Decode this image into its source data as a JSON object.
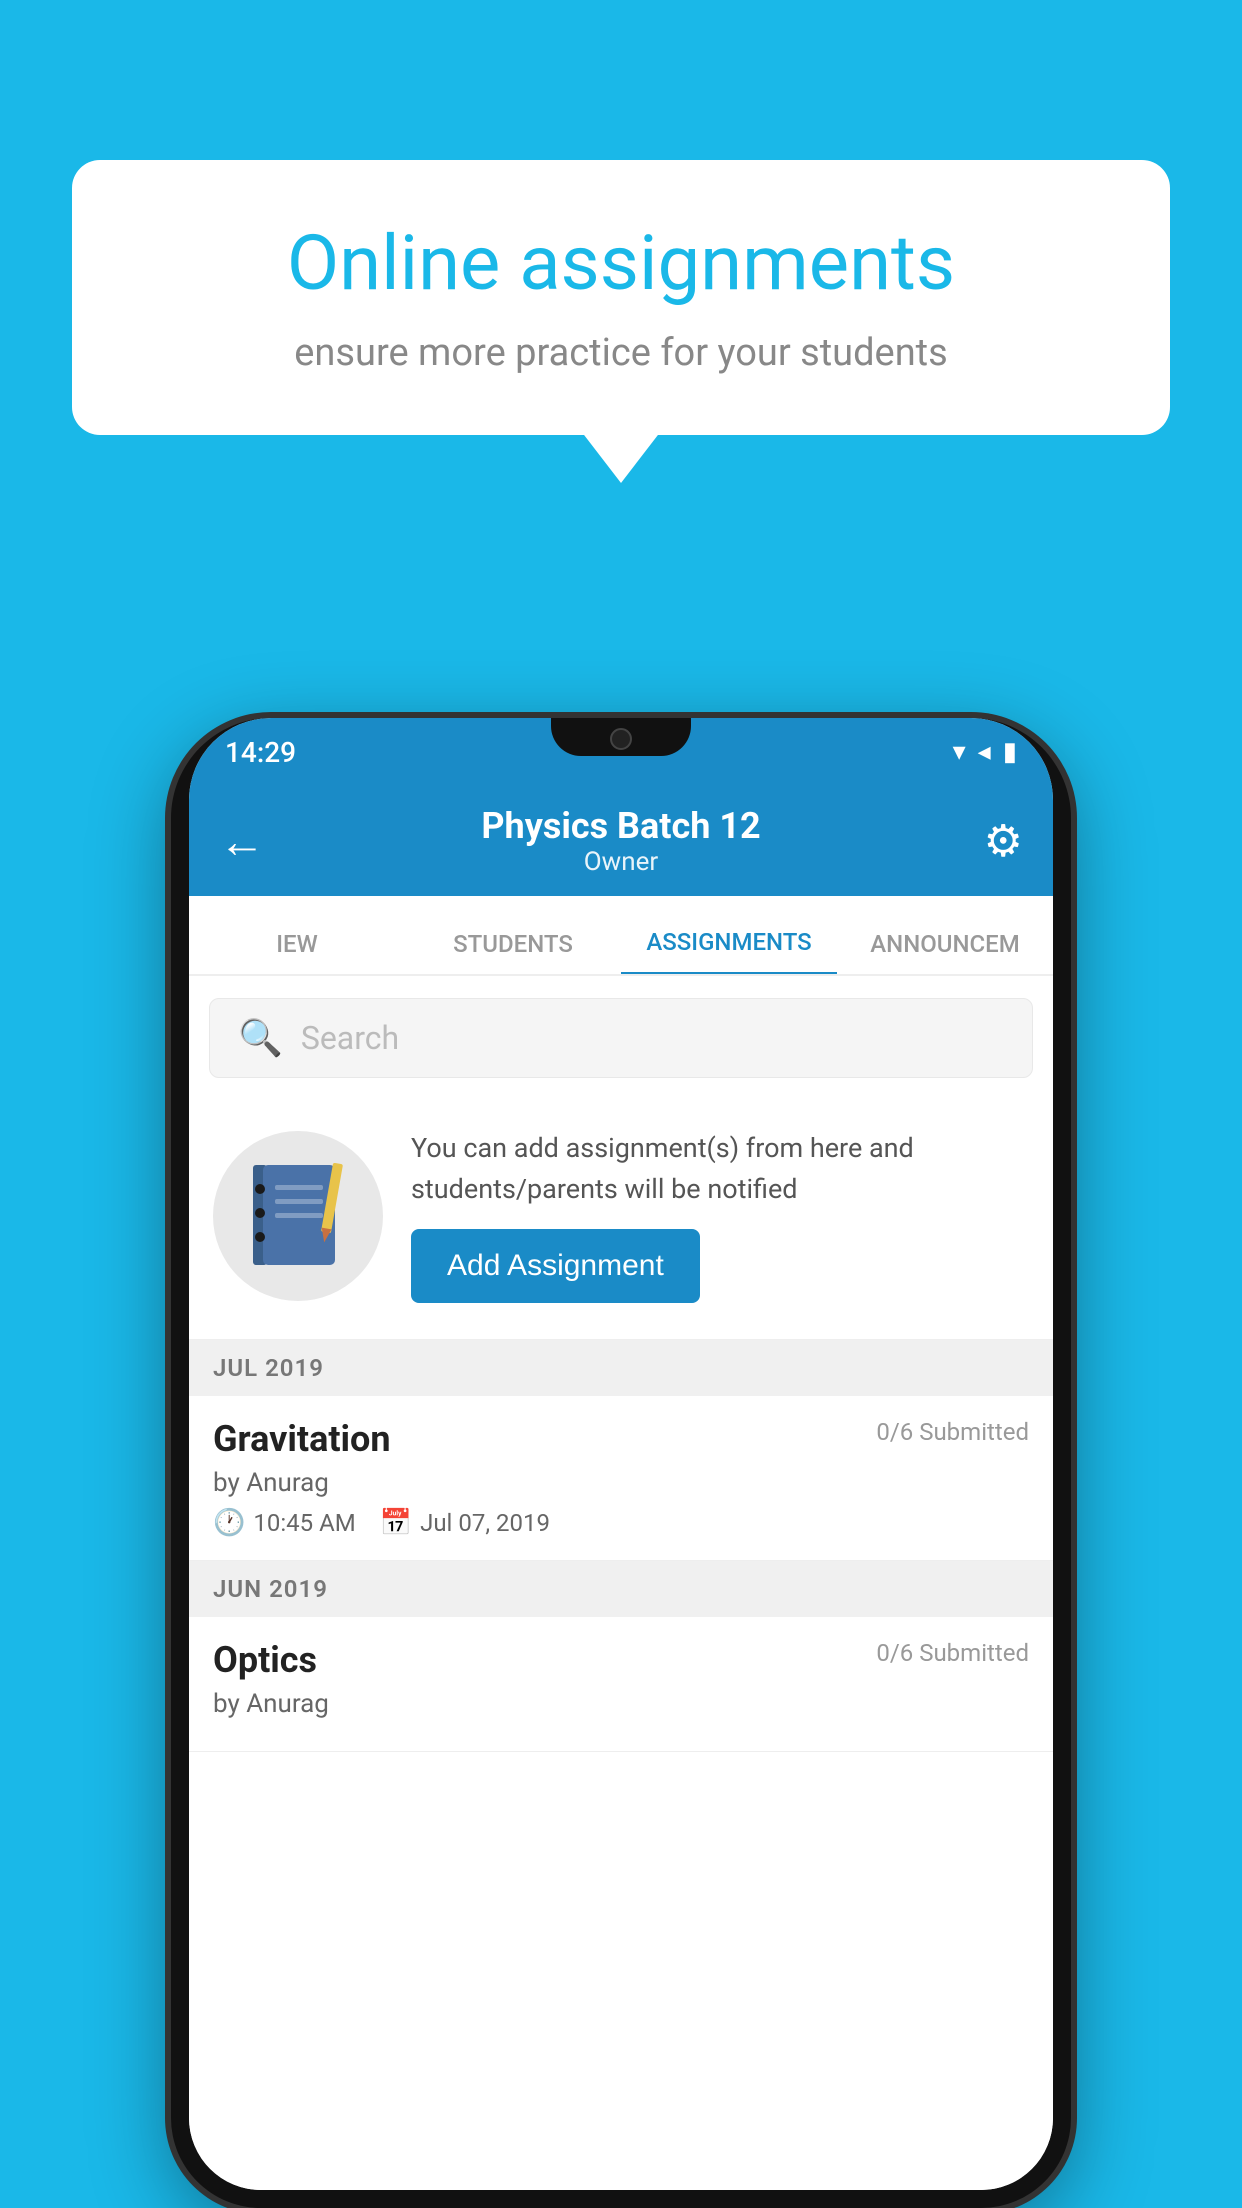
{
  "background_color": "#1ab8e8",
  "speech_bubble": {
    "title": "Online assignments",
    "subtitle": "ensure more practice for your students"
  },
  "phone": {
    "status_bar": {
      "time": "14:29",
      "icons": [
        "wifi",
        "signal",
        "battery"
      ]
    },
    "header": {
      "back_label": "←",
      "title": "Physics Batch 12",
      "subtitle": "Owner",
      "settings_label": "⚙"
    },
    "tabs": [
      {
        "label": "IEW",
        "active": false
      },
      {
        "label": "STUDENTS",
        "active": false
      },
      {
        "label": "ASSIGNMENTS",
        "active": true
      },
      {
        "label": "ANNOUNCEM...",
        "active": false
      }
    ],
    "search": {
      "placeholder": "Search"
    },
    "promo": {
      "description": "You can add assignment(s) from here and students/parents will be notified",
      "button_label": "Add Assignment"
    },
    "sections": [
      {
        "header": "JUL 2019",
        "assignments": [
          {
            "name": "Gravitation",
            "submitted": "0/6 Submitted",
            "by": "by Anurag",
            "time": "10:45 AM",
            "date": "Jul 07, 2019"
          }
        ]
      },
      {
        "header": "JUN 2019",
        "assignments": [
          {
            "name": "Optics",
            "submitted": "0/6 Submitted",
            "by": "by Anurag",
            "time": "",
            "date": ""
          }
        ]
      }
    ]
  }
}
